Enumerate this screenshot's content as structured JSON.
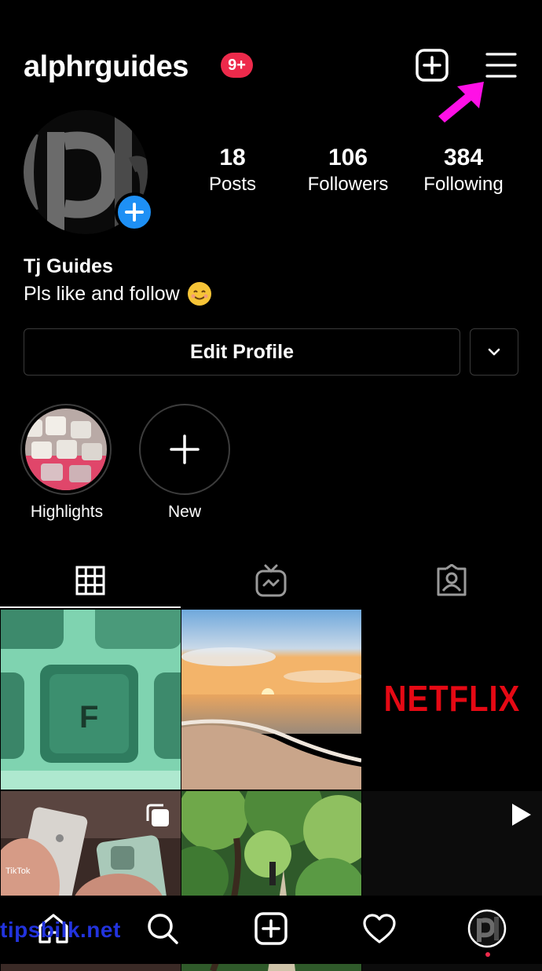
{
  "header": {
    "username": "alphrguides",
    "notification_badge": "9+",
    "badge_color": "#ed2a4b",
    "icons": [
      "add-post-icon",
      "menu-hamburger-icon"
    ],
    "annotation_arrow_color": "#ff10e6"
  },
  "profile": {
    "avatar_text": "ph",
    "display_name": "Tj Guides",
    "bio": "Pls like and follow",
    "bio_emoji": "smiling-face-emoji",
    "stats": [
      {
        "value": "18",
        "label": "Posts"
      },
      {
        "value": "106",
        "label": "Followers"
      },
      {
        "value": "384",
        "label": "Following"
      }
    ]
  },
  "actions": {
    "edit_profile_label": "Edit Profile",
    "dropdown_icon": "chevron-down-icon"
  },
  "highlights": [
    {
      "label": "Highlights"
    },
    {
      "label": "New"
    }
  ],
  "tabs": [
    {
      "name": "grid-posts",
      "icon": "grid-icon",
      "active": true
    },
    {
      "name": "igtv",
      "icon": "igtv-icon",
      "active": false
    },
    {
      "name": "tagged",
      "icon": "tagged-user-icon",
      "active": false
    }
  ],
  "grid": {
    "tiles": [
      {
        "kind": "photo",
        "subject": "green keyboard key",
        "key_letter": "F"
      },
      {
        "kind": "photo",
        "subject": "beach sunset"
      },
      {
        "kind": "logo",
        "text": "NETFLIX",
        "color": "#e50914"
      },
      {
        "kind": "carousel",
        "subject": "phones in hand",
        "overlay_text": "TikTok"
      },
      {
        "kind": "photo",
        "subject": "forest path"
      },
      {
        "kind": "video",
        "subject": "dark video"
      }
    ]
  },
  "bottom_nav": {
    "items": [
      "home-icon",
      "search-icon",
      "new-post-icon",
      "activity-heart-icon",
      "profile-avatar-icon"
    ],
    "active_dot_color": "#ed2a4b"
  },
  "watermark": "tipsbilk.net"
}
